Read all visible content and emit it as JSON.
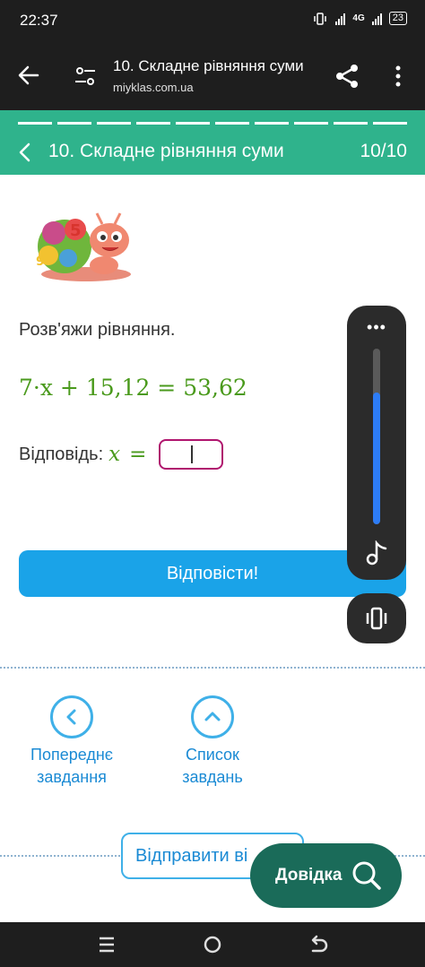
{
  "status_bar": {
    "time": "22:37",
    "network": "4G",
    "battery": "23"
  },
  "browser": {
    "title": "10. Складне рівняння суми",
    "url": "miyklas.com.ua"
  },
  "quiz_header": {
    "title": "10. Складне рівняння суми",
    "counter": "10/10",
    "progress_total": 10,
    "progress_done": 10,
    "color": "#2fb38c"
  },
  "task": {
    "prompt": "Розв'яжи рівняння.",
    "equation": "7·x + 15,12 = 53,62",
    "answer_label": "Відповідь:",
    "answer_var": "x",
    "answer_eq": "=",
    "answer_value": ""
  },
  "submit_button": {
    "label": "Відповісти!",
    "color": "#1aa3e8"
  },
  "navigation": {
    "previous": {
      "line1": "Попереднє",
      "line2": "завдання",
      "icon": "chevron-left-icon"
    },
    "list": {
      "line1": "Список",
      "line2": "завдань",
      "icon": "chevron-up-icon"
    }
  },
  "send_button": {
    "label": "Відправити ві"
  },
  "help_button": {
    "label": "Довідка",
    "icon": "search-icon",
    "color": "#1a6b59"
  },
  "volume_panel": {
    "level": 0.75,
    "icons": [
      "more-icon",
      "music-note-icon",
      "vibrate-icon"
    ]
  }
}
